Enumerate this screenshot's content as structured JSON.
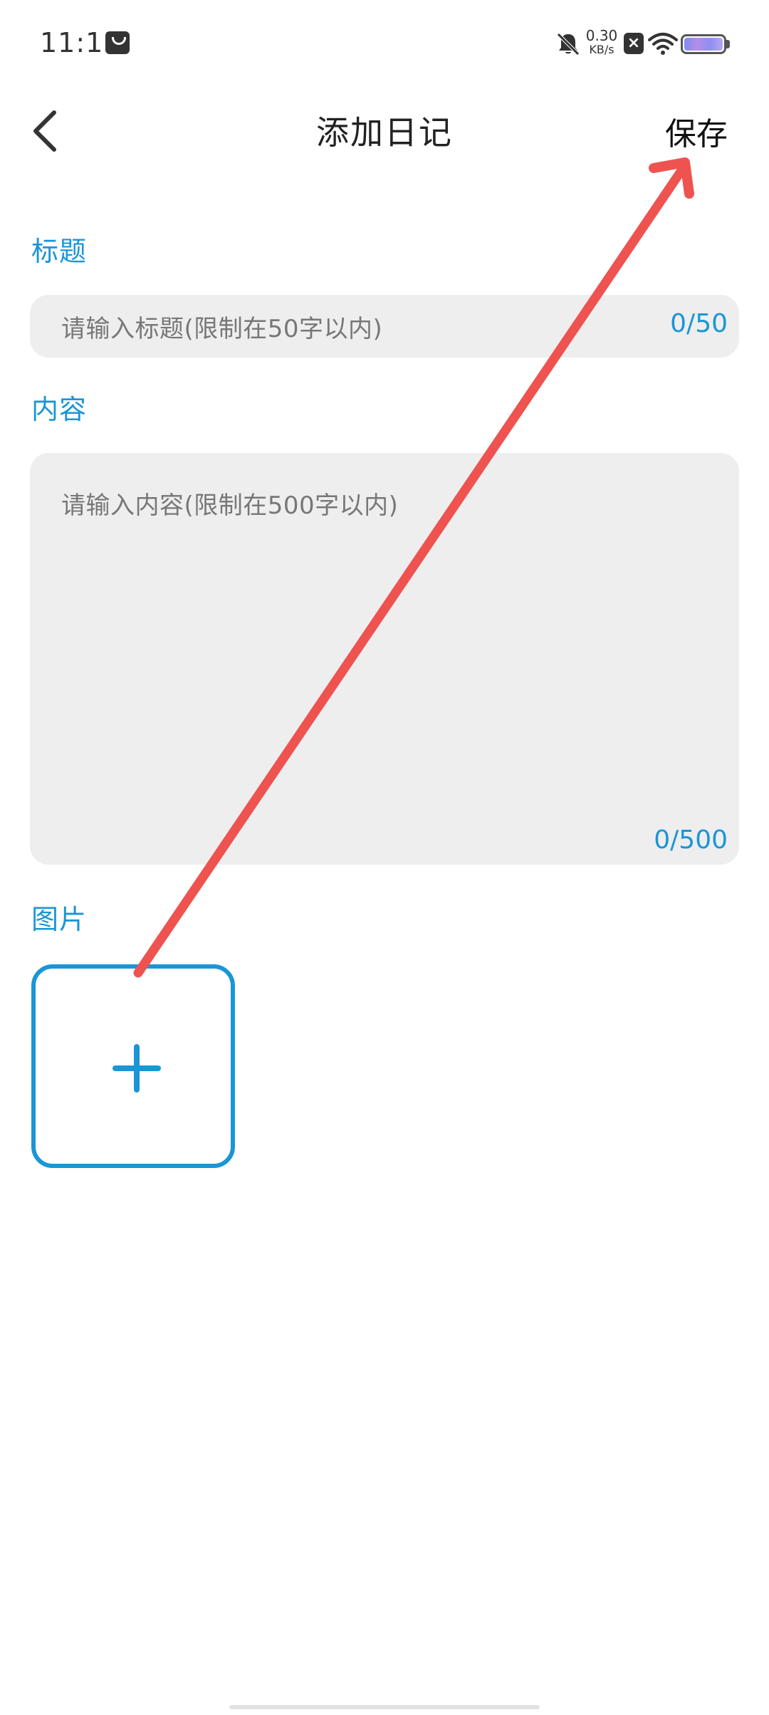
{
  "status_bar": {
    "time": "11:15",
    "net_speed_value": "0.30",
    "net_speed_unit": "KB/s",
    "icons": [
      "shopping-bag-icon",
      "bell-muted-icon",
      "close-box-icon",
      "wifi-icon",
      "battery-icon"
    ]
  },
  "header": {
    "title": "添加日记",
    "save_label": "保存",
    "back_icon": "chevron-left-icon"
  },
  "form": {
    "title_section": {
      "label": "标题",
      "placeholder": "请输入标题(限制在50字以内)",
      "counter": "0/50"
    },
    "content_section": {
      "label": "内容",
      "placeholder": "请输入内容(限制在500字以内)",
      "counter": "0/500"
    },
    "image_section": {
      "label": "图片",
      "add_icon": "plus-icon"
    }
  },
  "colors": {
    "accent": "#1a96d6",
    "field_background": "#eeeeee",
    "annotation_arrow": "#ee5350"
  }
}
